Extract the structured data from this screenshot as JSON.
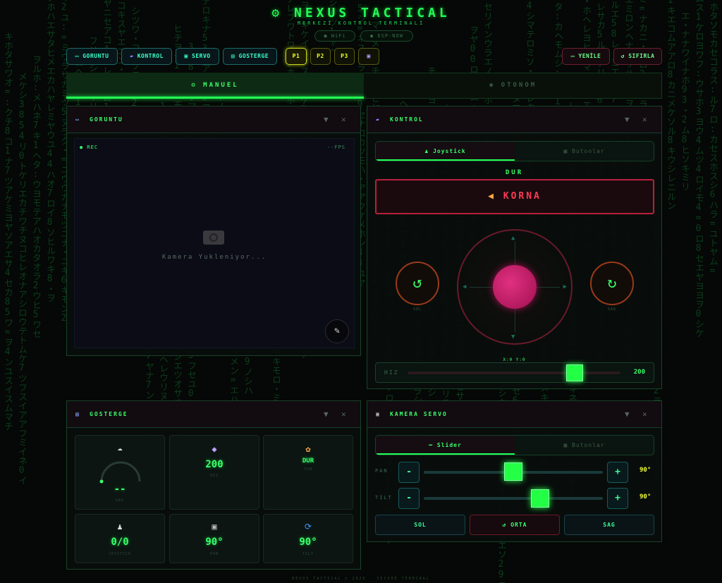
{
  "app": {
    "title": "NEXUS TACTICAL",
    "subtitle": "MERKEZİ KONTROL TERMİNALİ",
    "status_pills": [
      "WiFi",
      "ESP-NOW"
    ],
    "footer": "NEXUS TACTICAL © 2026 - SECURE TERMINAL"
  },
  "toolbar": {
    "panel_toggles": [
      "GORUNTU",
      "KONTROL",
      "SERVO",
      "GOSTERGE"
    ],
    "presets": [
      "P1",
      "P2",
      "P3"
    ],
    "active_preset": "P1",
    "refresh_label": "YENİLE",
    "reset_label": "SIFIRLA"
  },
  "mode": {
    "tabs": [
      "MANUEL",
      "OTONOM"
    ],
    "active": "MANUEL"
  },
  "camera_panel": {
    "title": "GORUNTU",
    "rec_label": "● REC",
    "fps_label": "--FPS",
    "loading_text": "Kamera Yukleniyor..."
  },
  "control_panel": {
    "title": "KONTROL",
    "tabs": [
      "Joystick",
      "Butonlar"
    ],
    "active_tab": "Joystick",
    "state_label": "DUR",
    "horn_label": "KORNA",
    "left_label": "SOL",
    "right_label": "SAG",
    "coords": "X:0 Y:0",
    "speed_label": "HIZ",
    "speed_value": 200,
    "speed_max": 255,
    "speed_display": "200"
  },
  "gauge_panel": {
    "title": "GOSTERGE",
    "tiles": [
      {
        "icon": "cloud-icon",
        "value": "--",
        "label": "GAZ"
      },
      {
        "icon": "gem-icon",
        "value": "200",
        "label": "HIZ"
      },
      {
        "icon": "palette-icon",
        "value": "DUR",
        "label": "YON"
      },
      {
        "icon": "joystick-icon",
        "value": "0/0",
        "label": "JOYSTICK"
      },
      {
        "icon": "camera-icon",
        "value": "90°",
        "label": "PAN"
      },
      {
        "icon": "refresh-icon",
        "value": "90°",
        "label": "TILT"
      }
    ]
  },
  "servo_panel": {
    "title": "KAMERA SERVO",
    "tabs": [
      "Slider",
      "Butonlar"
    ],
    "active_tab": "Slider",
    "pan_label": "PAN",
    "pan_value": 90,
    "pan_display": "90°",
    "tilt_label": "TİLT",
    "tilt_value": 90,
    "tilt_display": "90°",
    "buttons": [
      "SOL",
      "ORTA",
      "SAG"
    ],
    "center_label": "ORTA"
  },
  "colors": {
    "accent_green": "#22ff55",
    "accent_cyan": "#3affc8",
    "accent_yellow": "#f0ff30",
    "horn_red": "#ff3a55",
    "joystick_knob": "#d0206a"
  }
}
